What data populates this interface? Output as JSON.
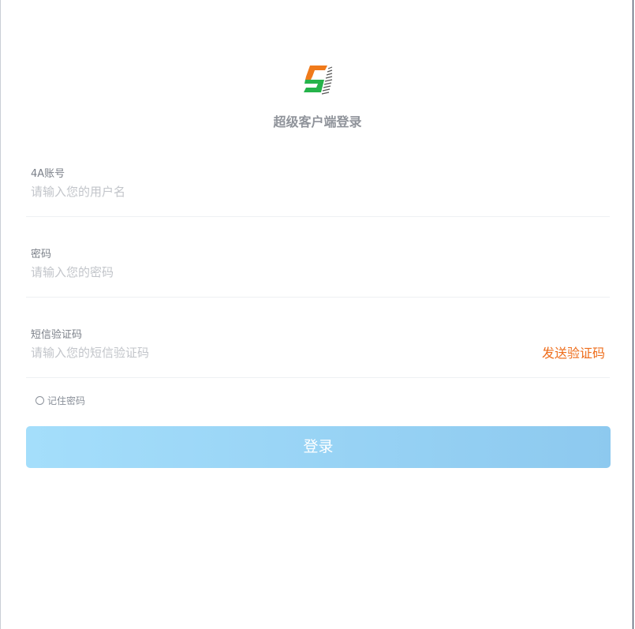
{
  "login": {
    "title": "超级客户端登录",
    "fields": [
      {
        "label": "4A账号",
        "placeholder": "请输入您的用户名",
        "value": ""
      },
      {
        "label": "密码",
        "placeholder": "请输入您的密码",
        "value": ""
      },
      {
        "label": "短信验证码",
        "placeholder": "请输入您的短信验证码",
        "value": ""
      }
    ],
    "send_code_label": "发送验证码",
    "remember_label": "记住密码",
    "remember_checked": false,
    "submit_label": "登录"
  },
  "colors": {
    "logo_orange": "#f07a1a",
    "logo_green": "#25b34a",
    "accent_orange": "#ee6d1b",
    "button_start": "#a4defb",
    "button_end": "#8dc9ef",
    "label_gray": "#7b8089"
  },
  "icons": {
    "logo": "s-brand-logo-icon",
    "remember": "radio-circle-icon"
  }
}
